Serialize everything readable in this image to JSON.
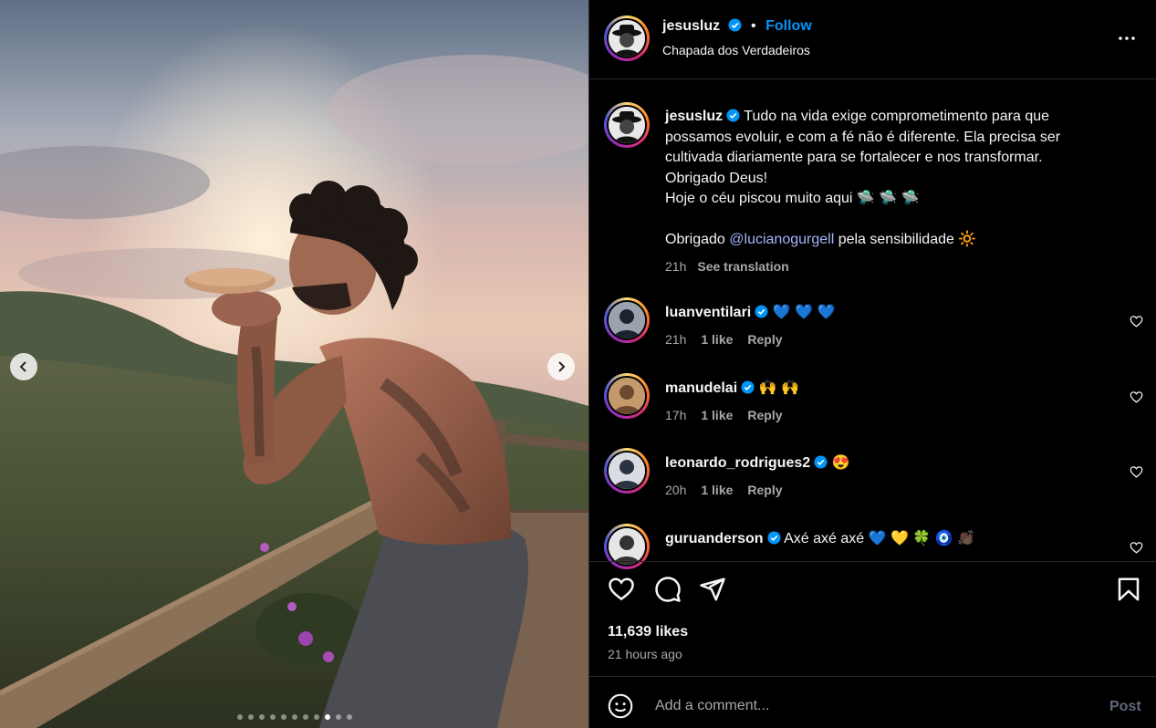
{
  "header": {
    "username": "jesusluz",
    "separator": "•",
    "follow_label": "Follow",
    "location": "Chapada dos Verdadeiros",
    "more_label": "•••"
  },
  "caption": {
    "username": "jesusluz",
    "line1": "Tudo na vida exige comprometimento para que possamos evoluir, e com a fé não é diferente. Ela precisa ser cultivada diariamente para se fortalecer e nos transformar.",
    "line2": "Obrigado Deus!",
    "line3": "Hoje o céu piscou muito aqui 🛸 🛸 🛸",
    "thanks_prefix": "Obrigado ",
    "mention": "@lucianogurgell",
    "thanks_suffix": " pela sensibilidade 🔆",
    "time": "21h",
    "see_translation": "See translation"
  },
  "comments": [
    {
      "username": "luanventilari",
      "text": "💙 💙 💙",
      "time": "21h",
      "likes": "1 like",
      "reply": "Reply"
    },
    {
      "username": "manudelai",
      "text": "🙌 🙌",
      "time": "17h",
      "likes": "1 like",
      "reply": "Reply"
    },
    {
      "username": "leonardo_rodrigues2",
      "text": "😍",
      "time": "20h",
      "likes": "1 like",
      "reply": "Reply"
    },
    {
      "username": "guruanderson",
      "text": "Axé axé axé 💙 💛 🍀 🧿 👏🏿",
      "time": "",
      "likes": "",
      "reply": ""
    }
  ],
  "actions": {
    "likes": "11,639 likes",
    "posted": "21 hours ago"
  },
  "add_comment": {
    "placeholder": "Add a comment...",
    "post_label": "Post"
  },
  "carousel": {
    "total": 11,
    "active_index": 8
  },
  "colors": {
    "accent": "#0095f6",
    "mention": "#a5b4fc",
    "background": "#000000",
    "muted": "#a8a8a8"
  },
  "icons": [
    "verified-icon",
    "more-icon",
    "heart-icon",
    "comment-icon",
    "share-icon",
    "bookmark-icon",
    "emoji-icon",
    "chevron-left-icon",
    "chevron-right-icon"
  ]
}
